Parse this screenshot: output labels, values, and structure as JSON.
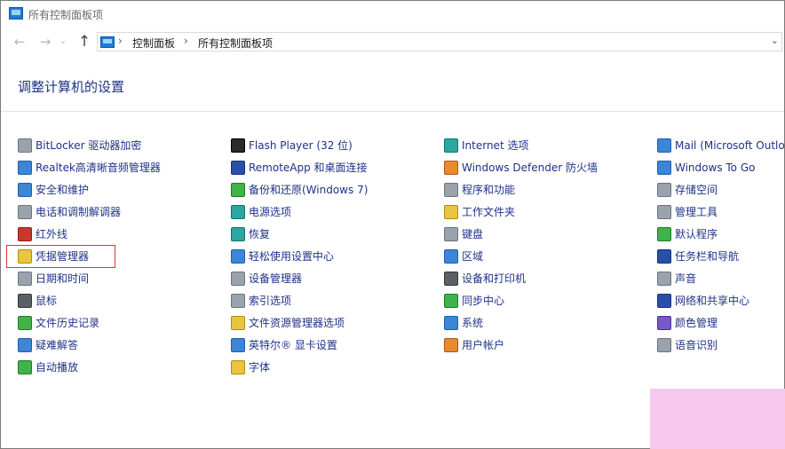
{
  "window": {
    "title": "所有控制面板项"
  },
  "nav": {
    "back_glyph": "←",
    "forward_glyph": "→",
    "dropdown_glyph": "⌄",
    "up_glyph": "↑"
  },
  "address": {
    "separator": "›",
    "crumbs": [
      "控制面板",
      "所有控制面板项"
    ],
    "dropdown_glyph": "⌄"
  },
  "page": {
    "heading": "调整计算机的设置"
  },
  "items": [
    {
      "label": "BitLocker 驱动器加密",
      "icon": "bitlocker-icon",
      "color": "gray"
    },
    {
      "label": "Realtek高清晰音频管理器",
      "icon": "audio-speaker-icon",
      "color": "blue"
    },
    {
      "label": "安全和维护",
      "icon": "flag-icon",
      "color": "blue"
    },
    {
      "label": "电话和调制解调器",
      "icon": "phone-modem-icon",
      "color": "gray"
    },
    {
      "label": "红外线",
      "icon": "infrared-icon",
      "color": "red"
    },
    {
      "label": "凭据管理器",
      "icon": "credential-vault-icon",
      "color": "yellow"
    },
    {
      "label": "日期和时间",
      "icon": "clock-icon",
      "color": "gray"
    },
    {
      "label": "鼠标",
      "icon": "mouse-icon",
      "color": "dark"
    },
    {
      "label": "文件历史记录",
      "icon": "file-history-icon",
      "color": "green"
    },
    {
      "label": "疑难解答",
      "icon": "troubleshoot-icon",
      "color": "blue"
    },
    {
      "label": "自动播放",
      "icon": "autoplay-icon",
      "color": "green"
    },
    {
      "label": "Flash Player (32 位)",
      "icon": "flash-icon",
      "color": "black"
    },
    {
      "label": "RemoteApp 和桌面连接",
      "icon": "remote-desktop-icon",
      "color": "navy"
    },
    {
      "label": "备份和还原(Windows 7)",
      "icon": "backup-icon",
      "color": "green"
    },
    {
      "label": "电源选项",
      "icon": "power-icon",
      "color": "teal"
    },
    {
      "label": "恢复",
      "icon": "recovery-icon",
      "color": "teal"
    },
    {
      "label": "轻松使用设置中心",
      "icon": "ease-of-access-icon",
      "color": "blue"
    },
    {
      "label": "设备管理器",
      "icon": "device-manager-icon",
      "color": "gray"
    },
    {
      "label": "索引选项",
      "icon": "index-icon",
      "color": "gray"
    },
    {
      "label": "文件资源管理器选项",
      "icon": "folder-options-icon",
      "color": "yellow"
    },
    {
      "label": "英特尔® 显卡设置",
      "icon": "intel-graphics-icon",
      "color": "blue"
    },
    {
      "label": "字体",
      "icon": "font-icon",
      "color": "yellow"
    },
    {
      "label": "Internet 选项",
      "icon": "internet-icon",
      "color": "teal"
    },
    {
      "label": "Windows Defender 防火墙",
      "icon": "firewall-icon",
      "color": "orange"
    },
    {
      "label": "程序和功能",
      "icon": "programs-icon",
      "color": "gray"
    },
    {
      "label": "工作文件夹",
      "icon": "work-folder-icon",
      "color": "yellow"
    },
    {
      "label": "键盘",
      "icon": "keyboard-icon",
      "color": "gray"
    },
    {
      "label": "区域",
      "icon": "region-icon",
      "color": "blue"
    },
    {
      "label": "设备和打印机",
      "icon": "printer-icon",
      "color": "dark"
    },
    {
      "label": "同步中心",
      "icon": "sync-icon",
      "color": "green"
    },
    {
      "label": "系统",
      "icon": "system-icon",
      "color": "blue"
    },
    {
      "label": "用户帐户",
      "icon": "user-accounts-icon",
      "color": "orange"
    },
    {
      "label": "Mail (Microsoft Outlo",
      "icon": "mail-icon",
      "color": "blue"
    },
    {
      "label": "Windows To Go",
      "icon": "windows-to-go-icon",
      "color": "blue"
    },
    {
      "label": "存储空间",
      "icon": "storage-icon",
      "color": "gray"
    },
    {
      "label": "管理工具",
      "icon": "admin-tools-icon",
      "color": "gray"
    },
    {
      "label": "默认程序",
      "icon": "default-programs-icon",
      "color": "green"
    },
    {
      "label": "任务栏和导航",
      "icon": "taskbar-icon",
      "color": "navy"
    },
    {
      "label": "声音",
      "icon": "sound-icon",
      "color": "gray"
    },
    {
      "label": "网络和共享中心",
      "icon": "network-icon",
      "color": "navy"
    },
    {
      "label": "颜色管理",
      "icon": "color-management-icon",
      "color": "purple"
    },
    {
      "label": "语音识别",
      "icon": "microphone-icon",
      "color": "gray"
    }
  ],
  "highlighted_item": "凭据管理器"
}
